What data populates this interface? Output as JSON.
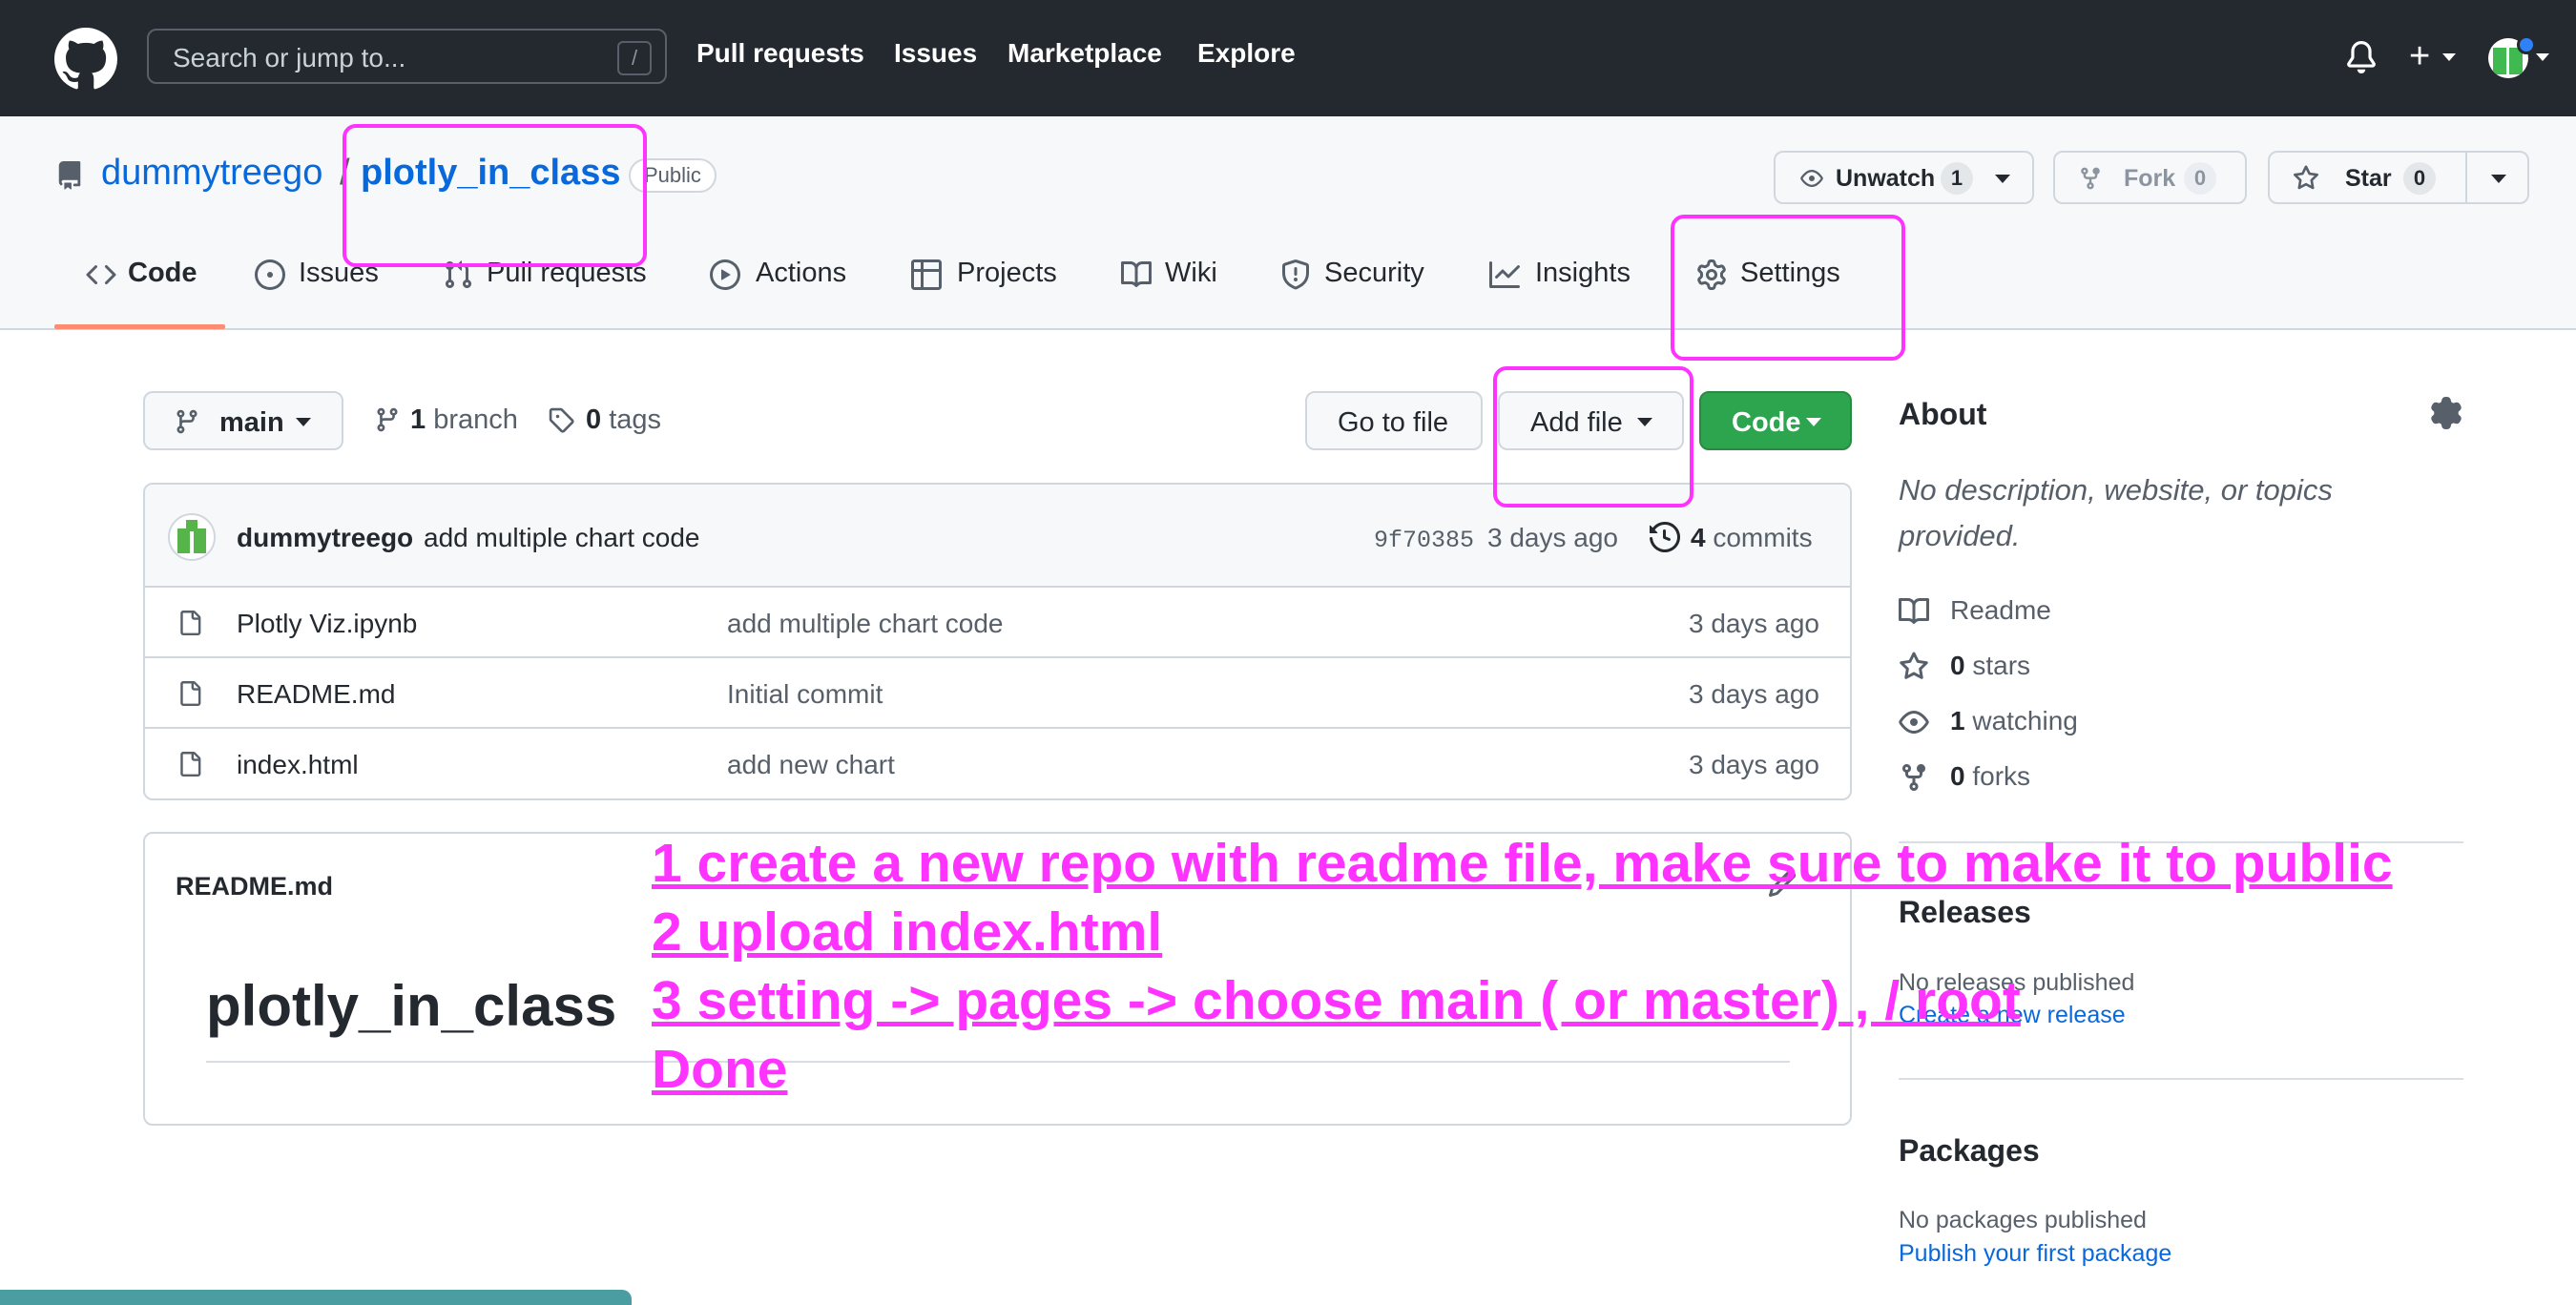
{
  "header": {
    "search_placeholder": "Search or jump to...",
    "search_shortcut": "/",
    "nav": [
      "Pull requests",
      "Issues",
      "Marketplace",
      "Explore"
    ]
  },
  "repo": {
    "owner": "dummytreego",
    "separator": "/",
    "name": "plotly_in_class",
    "visibility": "Public",
    "unwatch_label": "Unwatch",
    "watch_count": "1",
    "fork_label": "Fork",
    "fork_count": "0",
    "star_label": "Star",
    "star_count": "0"
  },
  "tabs": [
    {
      "label": "Code",
      "icon": "code-icon",
      "active": true
    },
    {
      "label": "Issues",
      "icon": "issue-icon"
    },
    {
      "label": "Pull requests",
      "icon": "pull-request-icon"
    },
    {
      "label": "Actions",
      "icon": "play-icon"
    },
    {
      "label": "Projects",
      "icon": "table-icon"
    },
    {
      "label": "Wiki",
      "icon": "book-icon"
    },
    {
      "label": "Security",
      "icon": "shield-icon"
    },
    {
      "label": "Insights",
      "icon": "graph-icon"
    },
    {
      "label": "Settings",
      "icon": "gear-icon"
    }
  ],
  "toolbar": {
    "branch": "main",
    "branch_count": "1",
    "branch_word": "branch",
    "tag_count": "0",
    "tag_word": "tags",
    "go_to_file": "Go to file",
    "add_file": "Add file",
    "code": "Code"
  },
  "commit": {
    "author": "dummytreego",
    "message": "add multiple chart code",
    "sha": "9f70385",
    "date": "3 days ago",
    "count": "4",
    "count_word": "commits"
  },
  "files": [
    {
      "name": "Plotly Viz.ipynb",
      "message": "add multiple chart code",
      "date": "3 days ago"
    },
    {
      "name": "README.md",
      "message": "Initial commit",
      "date": "3 days ago"
    },
    {
      "name": "index.html",
      "message": "add new chart",
      "date": "3 days ago"
    }
  ],
  "readme": {
    "filename": "README.md",
    "heading": "plotly_in_class"
  },
  "about": {
    "title": "About",
    "description": "No description, website, or topics provided.",
    "readme": "Readme",
    "stars_count": "0",
    "stars_word": "stars",
    "watching_count": "1",
    "watching_word": "watching",
    "forks_count": "0",
    "forks_word": "forks"
  },
  "releases": {
    "title": "Releases",
    "none": "No releases published",
    "create_link": "Create a new release"
  },
  "packages": {
    "title": "Packages",
    "none": "No packages published",
    "publish_link": "Publish your first package"
  },
  "annotations": [
    "1 create a new repo with readme file, make sure to make it to public",
    "2 upload index.html",
    "3 setting -> pages -> choose main ( or master) , / root",
    "Done"
  ],
  "colors": {
    "annotation": "#ff33ff",
    "header_bg": "#24292f",
    "link": "#0969da",
    "green_button": "#2da44e"
  }
}
